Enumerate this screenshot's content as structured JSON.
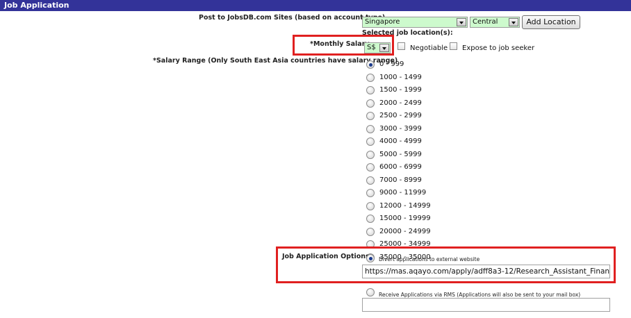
{
  "header": {
    "title": "Job Application"
  },
  "post_sites": {
    "label": "Post to JobsDB.com Sites (based on account type)",
    "country": "Singapore",
    "region": "Central",
    "add_location": "Add Location",
    "selected_label": "Selected job location(s):"
  },
  "salary": {
    "label": "*Monthly Salary",
    "currency": "S$",
    "negotiable": "Negotiable",
    "expose": "Expose to job seeker"
  },
  "salary_range": {
    "label": "*Salary Range (Only South East Asia countries have salary range)",
    "selected_index": 0,
    "options": [
      "0 - 999",
      "1000 - 1499",
      "1500 - 1999",
      "2000 - 2499",
      "2500 - 2999",
      "3000 - 3999",
      "4000 - 4999",
      "5000 - 5999",
      "6000 - 6999",
      "7000 - 8999",
      "9000 - 11999",
      "12000 - 14999",
      "15000 - 19999",
      "20000 - 24999",
      "25000 - 34999",
      "35000 - 35000"
    ]
  },
  "job_app": {
    "label": "Job Application Options",
    "divert_label": "Divert applications to external website",
    "url": "https://mas.aqayo.com/apply/adff8a3-12/Research_Assistant_Financ",
    "rms_label": "Receive Applications via RMS (Applications will also be sent to your mail box)",
    "rms_value": ""
  },
  "colors": {
    "header_bg": "#333399",
    "select_bg": "#cdfacd",
    "highlight": "#e02020"
  }
}
